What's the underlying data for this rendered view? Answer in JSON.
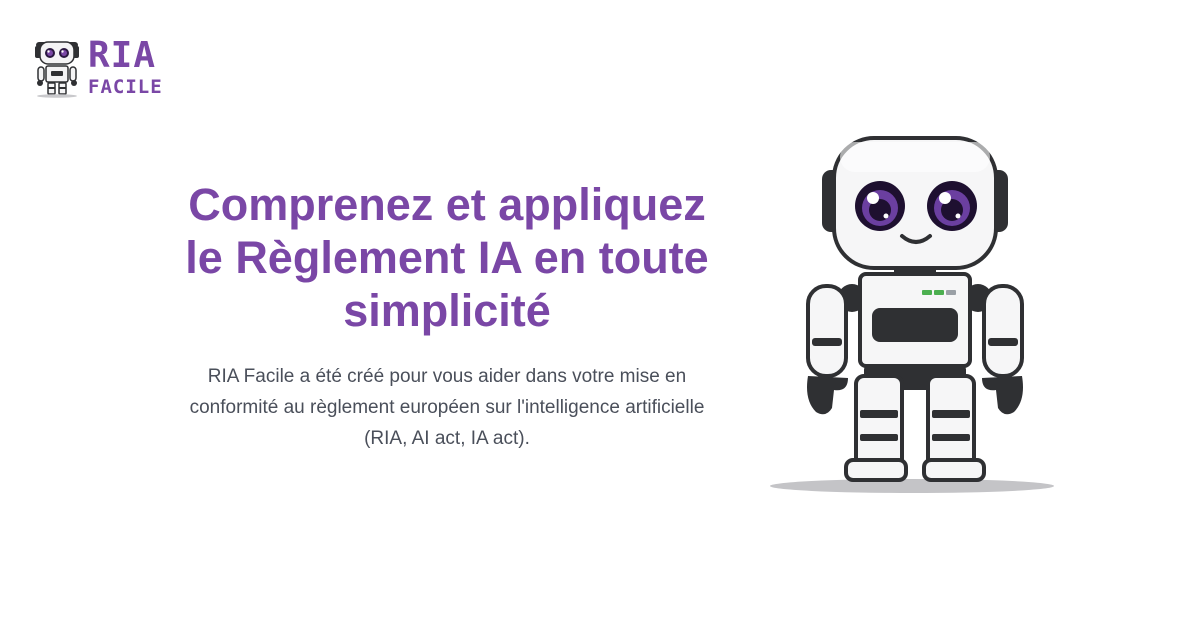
{
  "logo": {
    "title": "RIA",
    "subtitle": "FACILE",
    "icon": "robot-mascot-icon"
  },
  "hero": {
    "title_lines": [
      "Comprenez et appliquez",
      "le Règlement IA en toute",
      "simplicité"
    ],
    "description_lines": [
      "RIA Facile a été créé pour vous aider dans votre mise en",
      "conformité au règlement européen sur l'intelligence artificielle",
      "(RIA, AI act, IA act)."
    ]
  },
  "illustration": {
    "icon": "robot-mascot-illustration"
  },
  "colors": {
    "brand": "#7a47a6",
    "text": "#4a4f5a",
    "background": "#ffffff",
    "robot_dark": "#2f3033",
    "robot_eye": "#6b3fa0"
  }
}
